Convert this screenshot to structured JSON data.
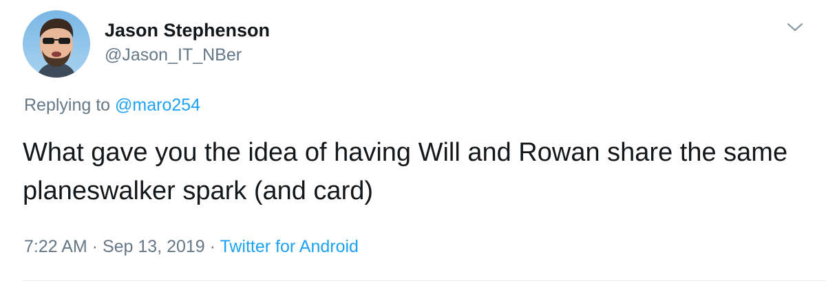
{
  "author": {
    "display_name": "Jason Stephenson",
    "handle": "@Jason_IT_NBer",
    "avatar_icon": "user-avatar-photo"
  },
  "reply": {
    "prefix": "Replying to ",
    "mention": "@maro254"
  },
  "tweet": {
    "text": "What gave you the idea of having Will and Rowan share the same planeswalker spark (and card)"
  },
  "meta": {
    "time": "7:22 AM",
    "separator1": " · ",
    "date": "Sep 13, 2019",
    "separator2": " · ",
    "source": "Twitter for Android"
  },
  "menu": {
    "icon": "chevron-down-icon"
  },
  "colors": {
    "text": "#14171a",
    "secondary": "#657786",
    "link": "#1da1f2",
    "divider": "#e6ecf0"
  }
}
